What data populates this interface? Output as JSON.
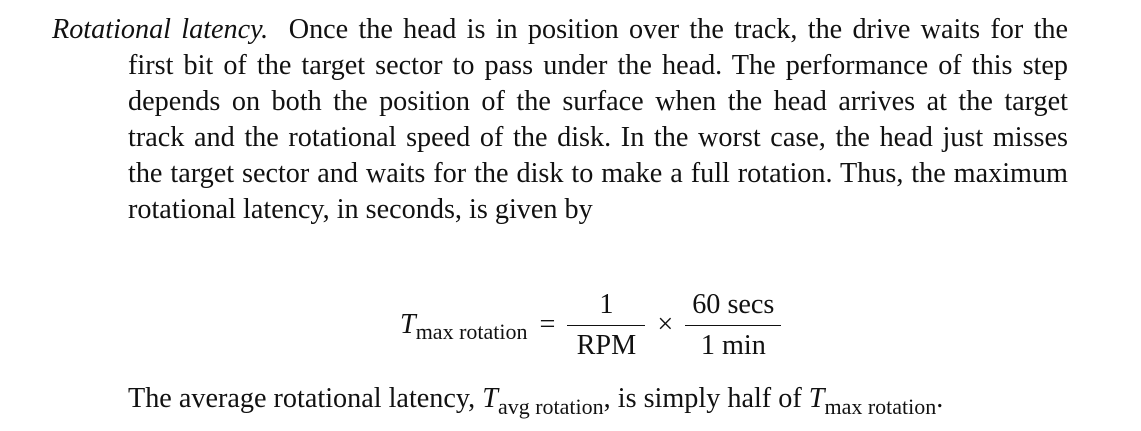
{
  "paragraph": {
    "term": "Rotational latency.",
    "body": "Once the head is in position over the track, the drive waits for the first bit of the target sector to pass under the head. The performance of this step depends on both the position of the surface when the head arrives at the target track and the rotational speed of the disk. In the worst case, the head just misses the target sector and waits for the disk to make a full rotation. Thus, the maximum rotational latency, in seconds, is given by"
  },
  "equation": {
    "lhs_var": "T",
    "lhs_sub": "max rotation",
    "equals": "=",
    "frac1_num": "1",
    "frac1_den": "RPM",
    "times": "×",
    "frac2_num": "60 secs",
    "frac2_den": "1 min"
  },
  "closing": {
    "text1": "The average rotational latency, ",
    "var1": "T",
    "sub1": "avg rotation",
    "text2": ", is simply half of ",
    "var2": "T",
    "sub2": "max rotation",
    "text3": "."
  }
}
